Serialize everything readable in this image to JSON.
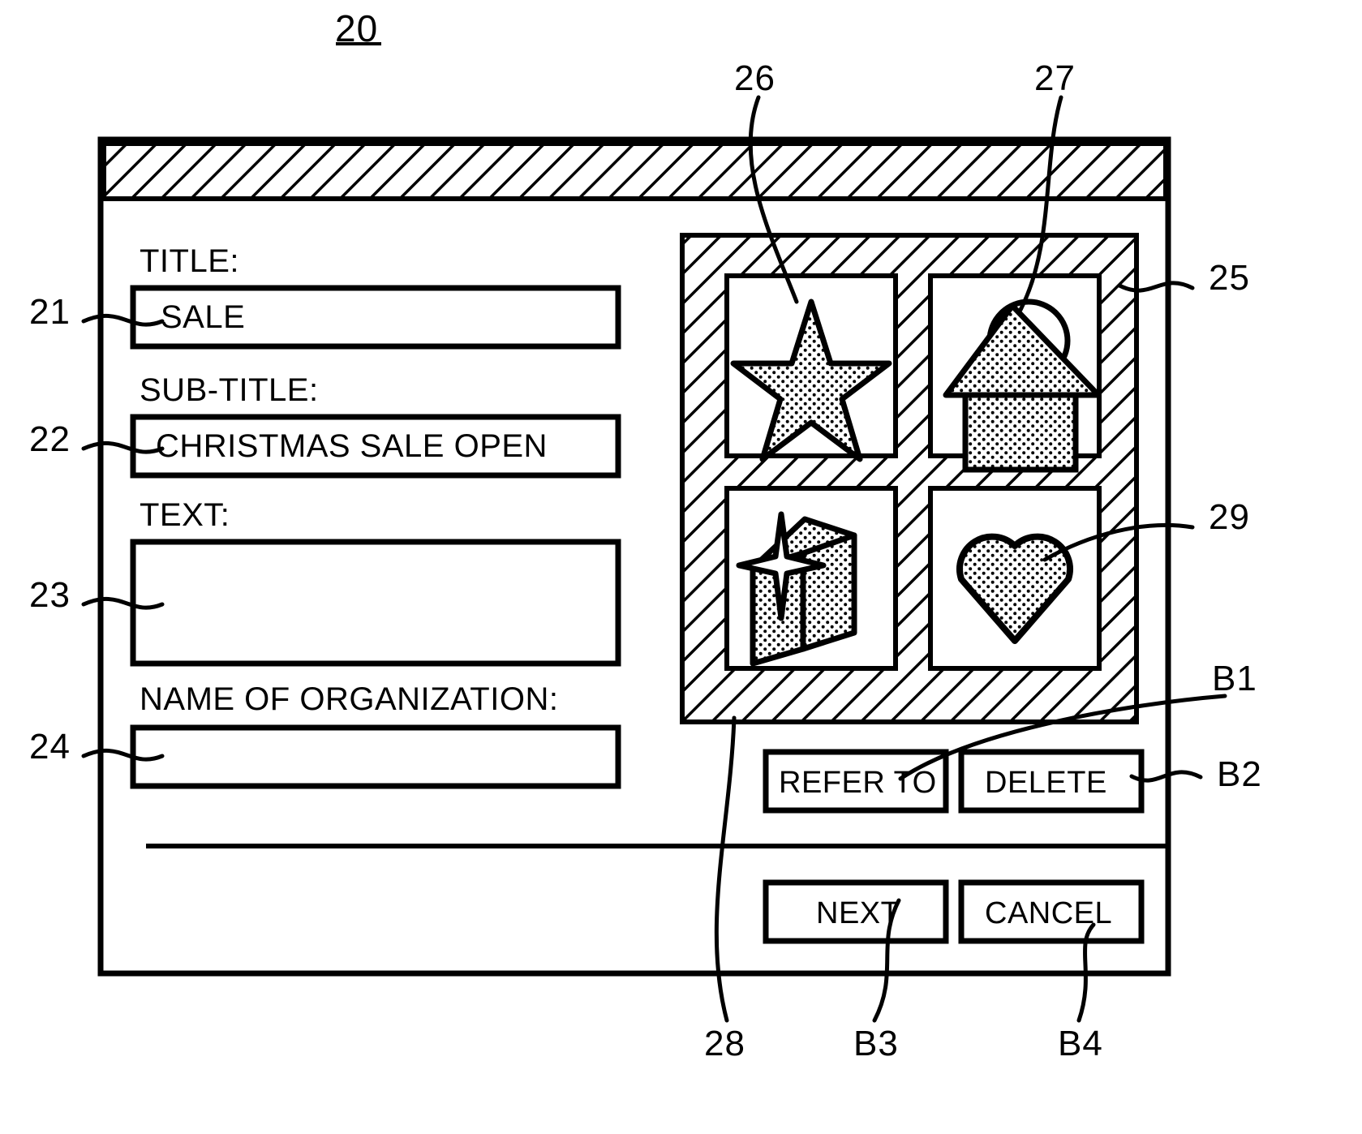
{
  "figure": {
    "number": "20",
    "underlined": true
  },
  "dialog": {
    "titlebar": {
      "style": "hatched",
      "label": ""
    },
    "form": {
      "fields": [
        {
          "ref": "21",
          "label": "TITLE:",
          "value": "SALE",
          "placeholder": "",
          "type": "text"
        },
        {
          "ref": "22",
          "label": "SUB-TITLE:",
          "value": "CHRISTMAS SALE OPEN",
          "placeholder": "",
          "type": "text"
        },
        {
          "ref": "23",
          "label": "TEXT:",
          "value": "",
          "placeholder": "",
          "type": "textarea"
        },
        {
          "ref": "24",
          "label": "NAME OF ORGANIZATION:",
          "value": "",
          "placeholder": "",
          "type": "text"
        }
      ]
    },
    "image_panel": {
      "ref": "25",
      "panel_ref": "28",
      "background": "hatched",
      "thumbnails": [
        {
          "ref": "26",
          "icon": "star-icon",
          "name": "star",
          "fill": "stipple"
        },
        {
          "ref": "27",
          "icon": "house-sun-icon",
          "name": "house with sun",
          "fill": "stipple"
        },
        {
          "ref": "",
          "icon": "cube-sparkle-icon",
          "name": "cube with sparkle",
          "fill": "stipple"
        },
        {
          "ref": "29",
          "icon": "heart-icon",
          "name": "heart",
          "fill": "stipple"
        }
      ]
    },
    "buttons": [
      {
        "ref": "B1",
        "label": "REFER TO"
      },
      {
        "ref": "B2",
        "label": "DELETE"
      },
      {
        "ref": "B3",
        "label": "NEXT"
      },
      {
        "ref": "B4",
        "label": "CANCEL"
      }
    ]
  },
  "reference_numerals": {
    "n20": "20",
    "n21": "21",
    "n22": "22",
    "n23": "23",
    "n24": "24",
    "n25": "25",
    "n26": "26",
    "n27": "27",
    "n28": "28",
    "n29": "29",
    "b1": "B1",
    "b2": "B2",
    "b3": "B3",
    "b4": "B4"
  },
  "colors": {
    "ink": "#000000",
    "paper": "#ffffff"
  }
}
